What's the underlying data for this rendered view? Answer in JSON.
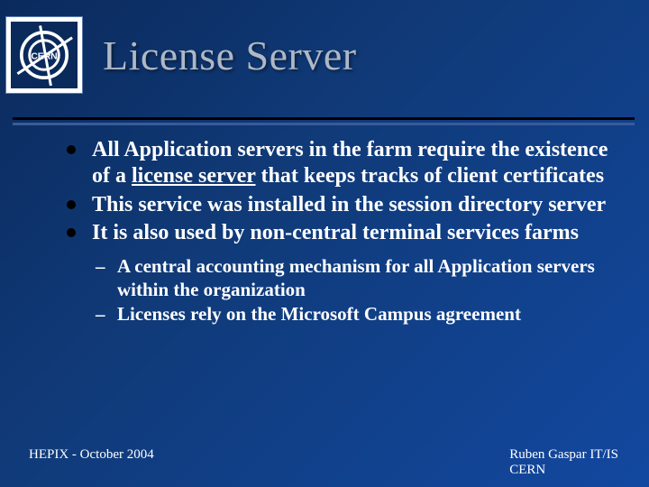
{
  "title": "License Server",
  "bullets": [
    {
      "pre": "All Application servers in the farm require the existence of a ",
      "u": "license server",
      "post": " that keeps tracks of client certificates"
    },
    {
      "pre": "This service was installed in the session directory server",
      "u": "",
      "post": ""
    },
    {
      "pre": "It is also used by non-central terminal services farms",
      "u": "",
      "post": ""
    }
  ],
  "sub_bullets": [
    "A central accounting mechanism for all Application servers within the organization",
    "Licenses rely on the Microsoft Campus agreement"
  ],
  "footer_left": "HEPIX - October 2004",
  "footer_right_line1": "Ruben Gaspar IT/IS",
  "footer_right_line2": "CERN",
  "logo_label": "CERN"
}
